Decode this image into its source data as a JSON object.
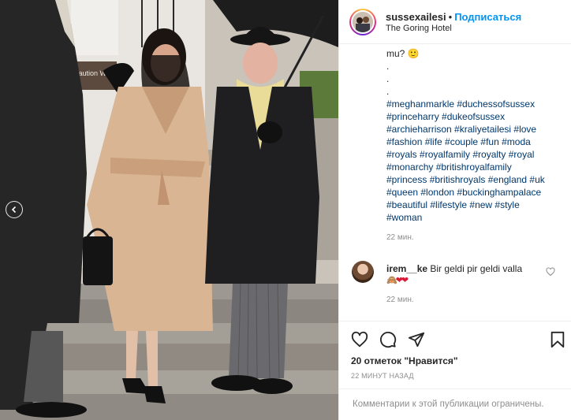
{
  "post": {
    "username": "sussexailesi",
    "separator": "•",
    "follow_label": "Подписаться",
    "location": "The Goring Hotel",
    "avatar_icon": "profile-avatar",
    "photo_sign_text": "Caution Wet Fl",
    "caption_lines": [
      "mu? 🙂",
      ".",
      ".",
      "."
    ],
    "hashtag_lines": [
      "#meghanmarkle #duchessofsussex",
      "#princeharry #dukeofsussex",
      "#archieharrison #kraliyetailesi #love",
      "#fashion #life #couple #fun #moda",
      "#royals #royalfamily #royalty #royal",
      "#monarchy #britishroyalfamily",
      "#princess #britishroyals #england #uk",
      "#queen #london #buckinghampalace",
      "#beautiful #lifestyle #new #style",
      "#woman"
    ],
    "caption_time": "22 мин.",
    "comment": {
      "user": "irem__ke",
      "text": "Bir geldi pir geldi valla",
      "emoji": "🙈❤❤",
      "time": "22 мин."
    },
    "likes_label": "20 отметок \"Нравится\"",
    "posted_ago": "22 МИНУТ НАЗАД",
    "comments_disabled": "Комментарии к этой публикации ограничены."
  },
  "icons": {
    "like": "heart-icon",
    "comment": "comment-icon",
    "share": "share-icon",
    "save": "bookmark-icon",
    "carousel_prev": "chevron-left-icon"
  },
  "colors": {
    "link_blue": "#0095f6",
    "hashtag": "#00376b",
    "muted": "#8e8e8e",
    "text": "#262626",
    "border": "#efefef"
  }
}
